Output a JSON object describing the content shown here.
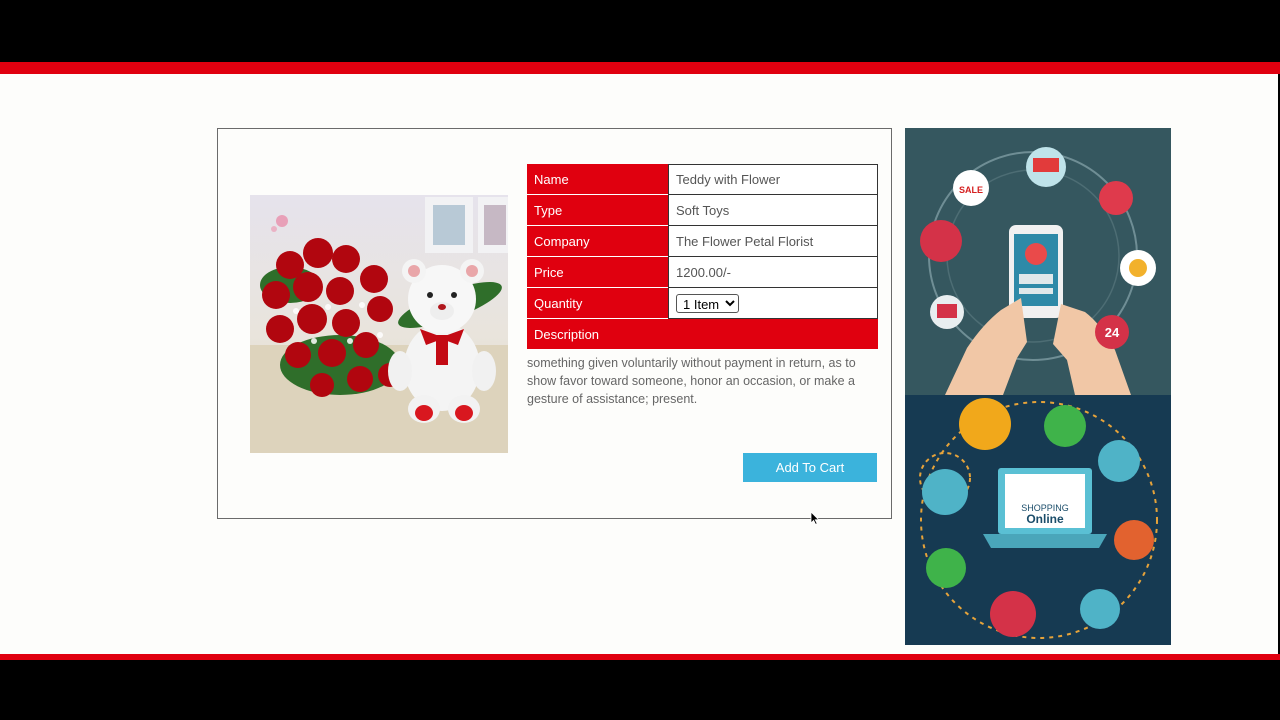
{
  "product": {
    "rows": [
      {
        "label": "Name",
        "value": "Teddy with Flower"
      },
      {
        "label": "Type",
        "value": "Soft Toys"
      },
      {
        "label": "Company",
        "value": "The Flower Petal Florist"
      },
      {
        "label": "Price",
        "value": "1200.00/-"
      },
      {
        "label": "Quantity",
        "value": "1 Item"
      }
    ],
    "description_label": "Description",
    "description": "something given voluntarily without payment in return, as to show favor toward someone, honor an occasion, or make a gesture of assistance; present.",
    "add_to_cart_label": "Add To Cart"
  },
  "banner": {
    "sale_badge": "SALE",
    "hours_badge": "24",
    "laptop_line1": "SHOPPING",
    "laptop_line2": "Online"
  },
  "colors": {
    "accent_red": "#e0000f",
    "button_blue": "#3bb3dc"
  }
}
